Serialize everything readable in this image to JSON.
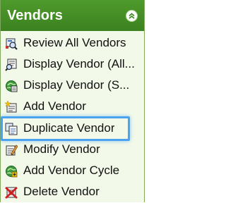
{
  "panel": {
    "title": "Vendors",
    "colors": {
      "header": "#3f8a22",
      "body": "#f3f9e9",
      "highlight": "#4aa3f0"
    }
  },
  "items": [
    {
      "label": "Review All Vendors",
      "icon": "review-vendors-icon"
    },
    {
      "label": "Display Vendor (All...",
      "icon": "display-vendor-icon"
    },
    {
      "label": "Display Vendor (S...",
      "icon": "display-vendor-summary-icon"
    },
    {
      "label": "Add Vendor",
      "icon": "add-vendor-icon"
    },
    {
      "label": "Duplicate Vendor",
      "icon": "duplicate-vendor-icon",
      "highlighted": true
    },
    {
      "label": "Modify Vendor",
      "icon": "modify-vendor-icon"
    },
    {
      "label": "Add Vendor Cycle",
      "icon": "add-vendor-cycle-icon"
    },
    {
      "label": "Delete Vendor",
      "icon": "delete-vendor-icon"
    }
  ]
}
